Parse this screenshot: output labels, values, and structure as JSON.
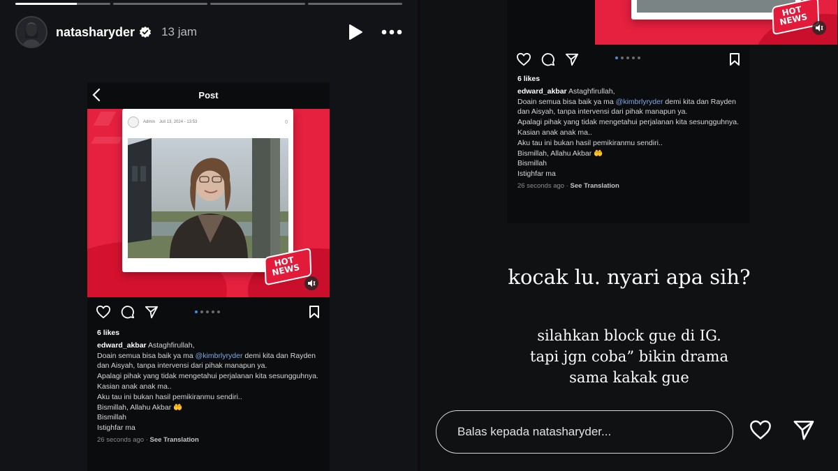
{
  "story": {
    "username": "natasharyder",
    "time_ago": "13 jam",
    "progress_segments": [
      1,
      0,
      0,
      0
    ],
    "progress_current_fraction": 0.65
  },
  "embedded_post": {
    "screen_title": "Post",
    "card_author": "Admin",
    "card_date": "Juli 13, 2024 - 13:53",
    "card_comment_count": "0",
    "badge_line1": "HOT",
    "badge_line2": "NEWS",
    "likes": "6 likes",
    "comment_user": "edward_akbar",
    "comment_first": "Astaghfirullah,",
    "comment_line2_pre": "Doain semua bisa baik ya ma ",
    "comment_mention": "@kimbrlyryder",
    "comment_line2_post": " demi kita dan Rayden dan Aisyah, tanpa intervensi dari pihak manapun ya.",
    "comment_line3": "Apalagi pihak yang tidak mengetahui perjalanan kita sesungguhnya.",
    "comment_line4": "Kasian anak anak ma..",
    "comment_line5": "Aku tau ini bukan hasil pemikiranmu sendiri..",
    "comment_line6": "Bismillah, Allahu Akbar 🤲",
    "comment_line7": "Bismillah",
    "comment_line8": "Istighfar ma",
    "comment_time": "26 seconds ago",
    "see_translation": "See Translation"
  },
  "story_text": {
    "big": "kocak lu. nyari apa sih?",
    "small_line1": "silahkan block gue di IG.",
    "small_line2": "tapi jgn coba” bikin drama",
    "small_line3": "sama kakak gue"
  },
  "reply": {
    "placeholder": "Balas kepada natasharyder..."
  },
  "colors": {
    "card_red": "#e6203f",
    "mention_blue": "#7fa8e6",
    "dot_active": "#3c8ef0"
  },
  "icons": [
    "play-icon",
    "more-icon",
    "verified-icon",
    "back-arrow-icon",
    "heart-icon",
    "comment-icon",
    "share-icon",
    "bookmark-icon",
    "volume-icon",
    "send-icon"
  ]
}
